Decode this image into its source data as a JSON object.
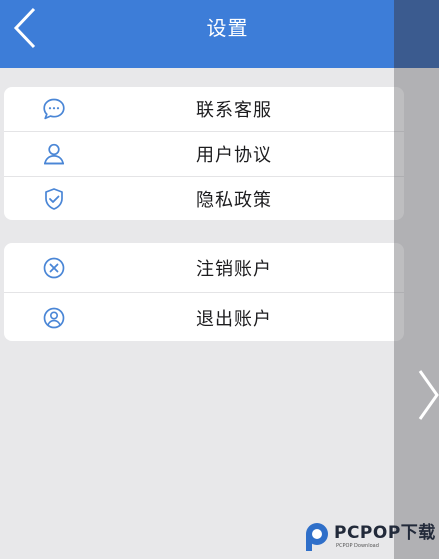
{
  "header": {
    "title": "设置"
  },
  "group1": [
    {
      "label": "联系客服",
      "icon": "chat-bubble-icon"
    },
    {
      "label": "用户协议",
      "icon": "user-icon"
    },
    {
      "label": "隐私政策",
      "icon": "shield-check-icon"
    }
  ],
  "group2": [
    {
      "label": "注销账户",
      "icon": "circle-x-icon"
    },
    {
      "label": "退出账户",
      "icon": "user-circle-icon"
    }
  ],
  "watermark": {
    "text": "PCPOP下载",
    "sub": "PCPOP Download"
  },
  "colors": {
    "header": "#3d7dd8",
    "icon": "#4a86d6",
    "background": "#e8e8ea"
  }
}
